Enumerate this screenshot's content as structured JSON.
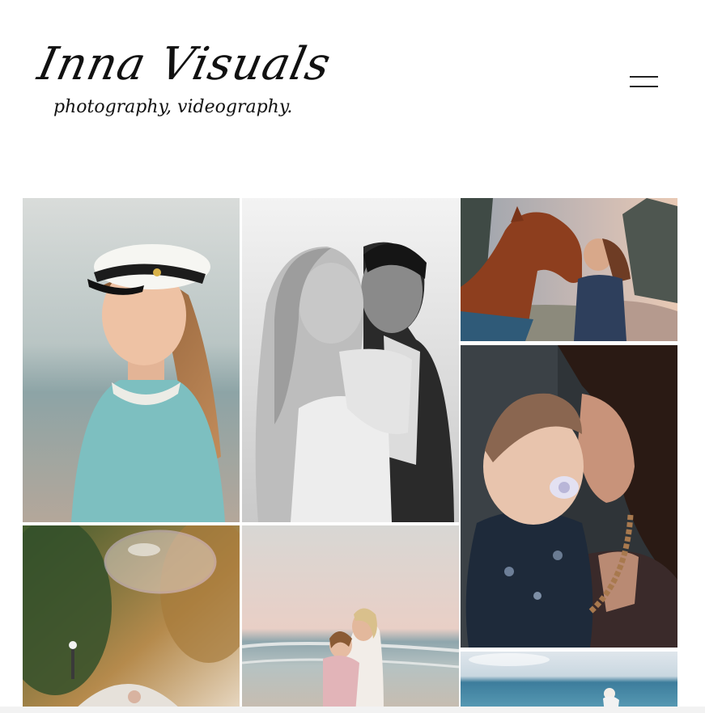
{
  "brand": {
    "title": "Inna Visuals",
    "tagline": "photography, videography."
  },
  "nav": {
    "menu_icon": "hamburger-menu-icon"
  },
  "gallery": {
    "photos": [
      {
        "subject": "graduate-portrait"
      },
      {
        "subject": "wedding-couple"
      },
      {
        "subject": "woman-with-horse"
      },
      {
        "subject": "mother-and-baby"
      },
      {
        "subject": "bubble-park"
      },
      {
        "subject": "beach-hug"
      },
      {
        "subject": "sea-horizon"
      }
    ]
  }
}
